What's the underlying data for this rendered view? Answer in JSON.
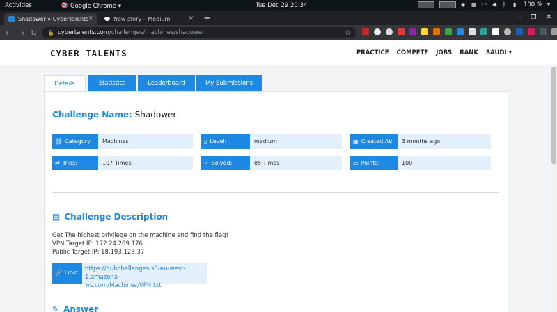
{
  "system": {
    "activities": "Activities",
    "app": "Google Chrome",
    "clock": "Tue Dec 29  20:34",
    "battery": "100 %"
  },
  "browser": {
    "tabs": [
      {
        "title": "Shadower » CyberTalents",
        "active": true
      },
      {
        "title": "New story – Medium",
        "active": false
      }
    ],
    "url_host": "cybertalents.com",
    "url_path": "/challenges/machines/shadower"
  },
  "site": {
    "logo": "CYBER TALENTS",
    "menu": [
      "PRACTICE",
      "COMPETE",
      "JOBS",
      "RANK",
      "SAUDI"
    ]
  },
  "page_tabs": [
    "Details",
    "Statistics",
    "Leaderboard",
    "My Submissions"
  ],
  "challenge": {
    "name_label": "Challenge Name:",
    "name": "Shadower",
    "info": {
      "category_label": "Category:",
      "category": "Machines",
      "level_label": "Level:",
      "level": "medium",
      "created_label": "Created At:",
      "created": "3 months ago",
      "tries_label": "Tries:",
      "tries": "107 Times",
      "solved_label": "Solved:",
      "solved": "85 Times",
      "points_label": "Points:",
      "points": "100"
    },
    "description_title": "Challenge Description",
    "description_lines": [
      "Get The highest privilege on the machine and find the flag!",
      "VPN Target IP: 172.24.209.176",
      "Public Target IP: 18.193.123.37"
    ],
    "link_label": "Link:",
    "link_line1": "https://hubchallenges.s3-eu-west-1.amazona",
    "link_line2": "ws.com/Machines/VPN.txt",
    "answer_title": "Answer"
  },
  "colors": {
    "accent": "#1e88e5",
    "accent_light": "#e3f0fc"
  }
}
